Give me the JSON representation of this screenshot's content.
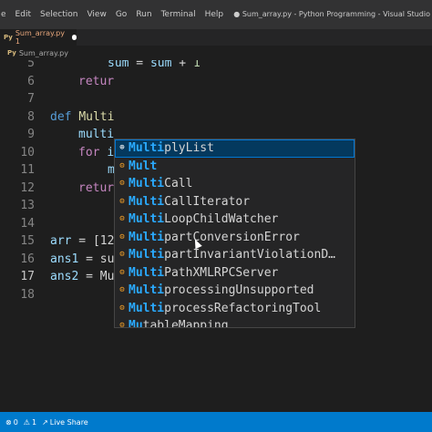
{
  "menubar": {
    "items": [
      "e",
      "Edit",
      "Selection",
      "View",
      "Go",
      "Run",
      "Terminal",
      "Help"
    ],
    "window_title": "● Sum_array.py - Python Programming - Visual Studio"
  },
  "tab": {
    "label": "Sum_array.py 1"
  },
  "breadcrumb": {
    "file": "Sum_array.py"
  },
  "editor": {
    "line_numbers": [
      "5",
      "6",
      "7",
      "8",
      "9",
      "10",
      "11",
      "12",
      "13",
      "14",
      "15",
      "16",
      "17",
      "18"
    ],
    "lines": {
      "l5": {
        "lhs": "sum",
        "eq": " = ",
        "rhs": "sum",
        "plus": " + ",
        "num": "1"
      },
      "l6": {
        "kw": "retur"
      },
      "l8": {
        "kw": "def",
        "name": "Multi"
      },
      "l9": {
        "text": "multi"
      },
      "l10": {
        "kw": "for",
        "text": "i"
      },
      "l11": {
        "text": "m"
      },
      "l12": {
        "kw": "retur"
      },
      "l15": {
        "var": "arr",
        "rest": " = [12"
      },
      "l16": {
        "var": "ans1",
        "rest": " = su"
      },
      "l17": {
        "var": "ans2",
        "rest": " = ",
        "typed": "Mu"
      }
    }
  },
  "suggest": {
    "items": [
      {
        "match": "Multi",
        "rest": "plyList"
      },
      {
        "match": "Mult",
        "rest": ""
      },
      {
        "match": "Multi",
        "rest": "Call"
      },
      {
        "match": "Multi",
        "rest": "CallIterator"
      },
      {
        "match": "Multi",
        "rest": "LoopChildWatcher"
      },
      {
        "match": "Multi",
        "rest": "partConversionError"
      },
      {
        "match": "Multi",
        "rest": "partInvariantViolationD…"
      },
      {
        "match": "Multi",
        "rest": "PathXMLRPCServer"
      },
      {
        "match": "Multi",
        "rest": "processingUnsupported"
      },
      {
        "match": "Multi",
        "rest": "processRefactoringTool"
      },
      {
        "match": "Mu",
        "rest": "tableMapping"
      }
    ]
  },
  "statusbar": {
    "problems_count": "0",
    "warnings_count": "1",
    "live_share": "Live Share"
  },
  "icons": {
    "class_icon": "⊕",
    "method_icon": "⚙",
    "error_icon": "⊗",
    "warning_icon": "⚠",
    "liveshare_icon": "↗"
  },
  "colors": {
    "accent": "#007acc",
    "selection": "#04395e",
    "match": "#2aaaff"
  }
}
